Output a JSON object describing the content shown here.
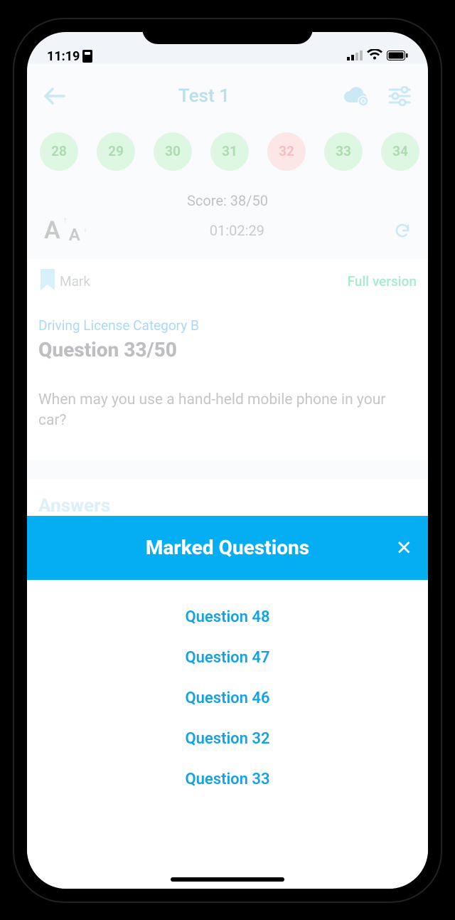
{
  "status": {
    "time": "11:19"
  },
  "header": {
    "title": "Test 1"
  },
  "chips": [
    {
      "n": "28",
      "state": "ok"
    },
    {
      "n": "29",
      "state": "ok"
    },
    {
      "n": "30",
      "state": "ok"
    },
    {
      "n": "31",
      "state": "ok"
    },
    {
      "n": "32",
      "state": "wrong"
    },
    {
      "n": "33",
      "state": "ok"
    },
    {
      "n": "34",
      "state": "ok"
    }
  ],
  "score_label": "Score: 38/50",
  "timer": "01:02:29",
  "mark_label": "Mark",
  "full_version_label": "Full version",
  "category": "Driving License Category B",
  "question_progress": "Question 33/50",
  "question_text": "When may you use a hand-held mobile phone in your car?",
  "answers_title": "Answers",
  "modal": {
    "title": "Marked Questions",
    "items": [
      "Question 48",
      "Question 47",
      "Question 46",
      "Question 32",
      "Question 33"
    ]
  },
  "font_a_large": "A",
  "font_a_small": "A"
}
